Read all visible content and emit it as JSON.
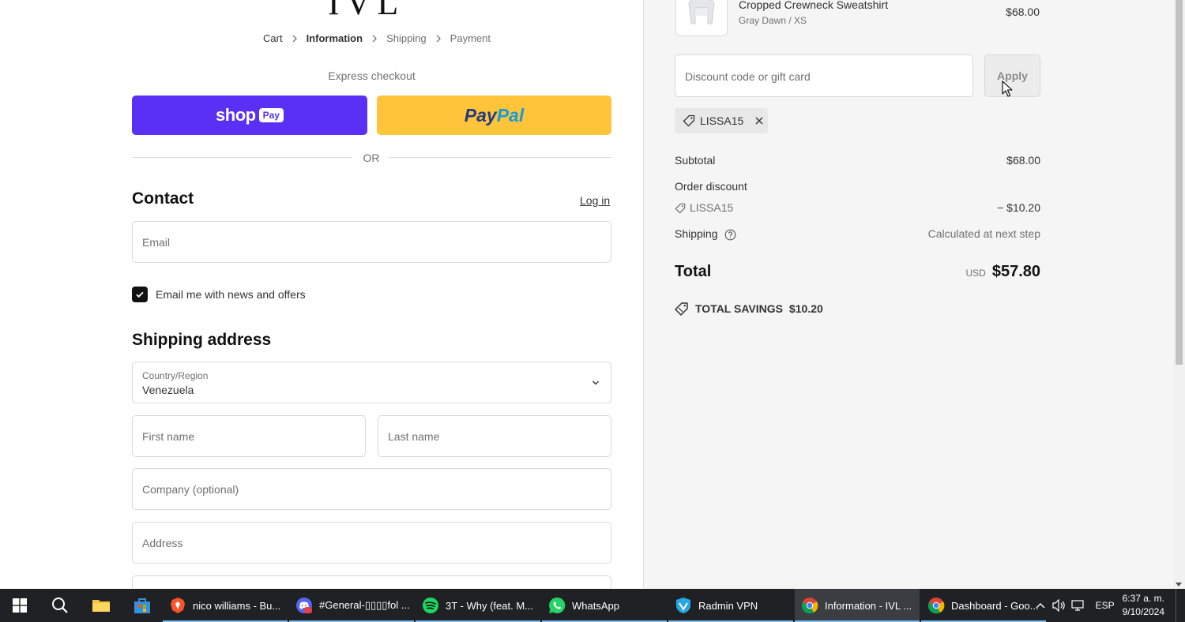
{
  "brand": {
    "logo_text": "IVL"
  },
  "breadcrumb": {
    "items": [
      {
        "label": "Cart",
        "state": "link"
      },
      {
        "label": "Information",
        "state": "current"
      },
      {
        "label": "Shipping",
        "state": "upcoming"
      },
      {
        "label": "Payment",
        "state": "upcoming"
      }
    ]
  },
  "express": {
    "title": "Express checkout",
    "shop_label": "shop",
    "shop_pay_label": "Pay",
    "paypal_a": "Pay",
    "paypal_b": "Pal",
    "or_label": "OR"
  },
  "contact": {
    "heading": "Contact",
    "login_label": "Log in",
    "email_placeholder": "Email",
    "newsletter_label": "Email me with news and offers",
    "newsletter_checked": true
  },
  "shipping_address": {
    "heading": "Shipping address",
    "country_label": "Country/Region",
    "country_value": "Venezuela",
    "first_name_placeholder": "First name",
    "last_name_placeholder": "Last name",
    "company_placeholder": "Company (optional)",
    "address_placeholder": "Address"
  },
  "summary": {
    "product": {
      "name": "Cropped Crewneck Sweatshirt",
      "variant": "Gray Dawn / XS",
      "price": "$68.00"
    },
    "discount_placeholder": "Discount code or gift card",
    "apply_label": "Apply",
    "applied_code": "LISSA15",
    "subtotal_label": "Subtotal",
    "subtotal_value": "$68.00",
    "order_discount_label": "Order discount",
    "discount_code": "LISSA15",
    "discount_value": "− $10.20",
    "shipping_label": "Shipping",
    "shipping_value": "Calculated at next step",
    "total_label": "Total",
    "total_currency": "USD",
    "total_value": "$57.80",
    "savings_label": "TOTAL SAVINGS",
    "savings_value": "$10.20"
  },
  "taskbar": {
    "tasks": [
      {
        "label": "nico williams - Bu...",
        "icon": "brave-icon",
        "active": false
      },
      {
        "label": "#General-▯▯▯▯fol ...",
        "icon": "discord-icon",
        "active": false
      },
      {
        "label": "3T - Why (feat. M...",
        "icon": "spotify-icon",
        "active": false
      },
      {
        "label": "WhatsApp",
        "icon": "whatsapp-icon",
        "active": false
      },
      {
        "label": "Radmin VPN",
        "icon": "radmin-icon",
        "active": false
      },
      {
        "label": "Information - IVL ...",
        "icon": "chrome-icon",
        "active": true
      },
      {
        "label": "Dashboard - Goo...",
        "icon": "chrome-icon",
        "active": false
      }
    ],
    "lang": "ESP",
    "time": "6:37 a. m.",
    "date": "9/10/2024"
  },
  "colors": {
    "shop_pay": "#5a31f4",
    "paypal": "#ffc439",
    "taskbar": "#202124",
    "summary_bg": "#f5f5f5"
  }
}
